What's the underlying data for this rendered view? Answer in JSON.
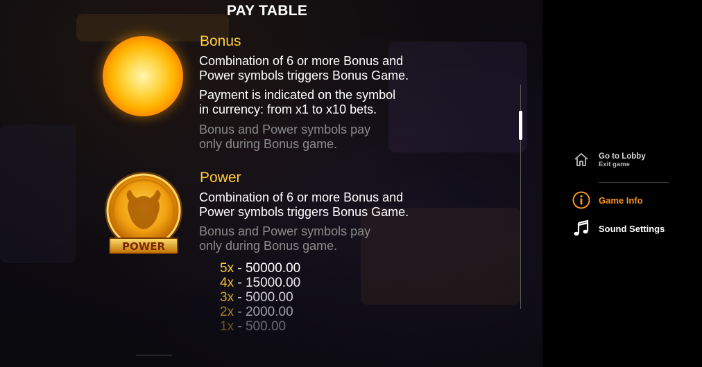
{
  "title": "PAY TABLE",
  "bonus": {
    "name": "Bonus",
    "desc1": [
      "Combination of 6 or more Bonus and",
      "Power symbols triggers Bonus Game."
    ],
    "desc2": [
      "Payment is indicated on the symbol",
      "in currency: from x1 to x10 bets."
    ],
    "note": [
      "Bonus and Power symbols pay",
      "only during Bonus game."
    ]
  },
  "power": {
    "name": "Power",
    "badge": "POWER",
    "desc1": [
      "Combination of 6 or more Bonus and",
      "Power symbols triggers Bonus Game."
    ],
    "note": [
      "Bonus and Power symbols pay",
      "only during Bonus game."
    ],
    "pays": [
      {
        "count": "5x",
        "sep": " - ",
        "amount": "50000.00"
      },
      {
        "count": "4x",
        "sep": " - ",
        "amount": "15000.00"
      },
      {
        "count": "3x",
        "sep": " - ",
        "amount": "5000.00"
      },
      {
        "count": "2x",
        "sep": " - ",
        "amount": "2000.00"
      },
      {
        "count": "1x",
        "sep": " - ",
        "amount": "500.00"
      }
    ]
  },
  "menu": {
    "lobby_label": "Go to Lobby",
    "lobby_sub": "Exit game",
    "info_label": "Game Info",
    "sound_label": "Sound Settings"
  },
  "colors": {
    "accent": "#ffcd3a",
    "menu_accent": "#f7941d",
    "text_gray": "#8a8a8a"
  },
  "icons": {
    "lobby": "home-icon",
    "info": "info-icon",
    "sound": "music-note-icon"
  }
}
